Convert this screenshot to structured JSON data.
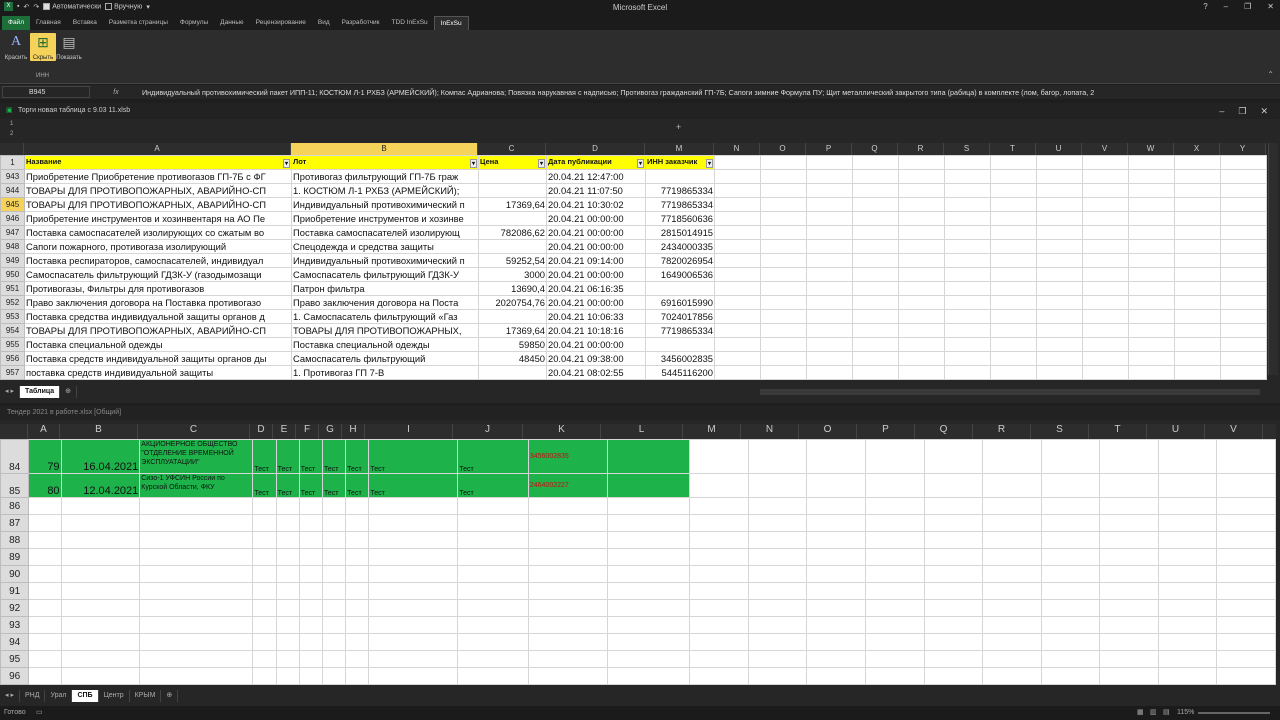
{
  "window": {
    "title": "Microsoft Excel"
  },
  "qat": {
    "auto_label": "Автоматически",
    "manual_label": "Вручную"
  },
  "ribbon_tabs": [
    "Файл",
    "Главная",
    "Вставка",
    "Разметка страницы",
    "Формулы",
    "Данные",
    "Рецензирование",
    "Вид",
    "Разработчик",
    "TDD InExSu",
    "InExSu"
  ],
  "ribbon": {
    "btn1": "Красить",
    "btn2": "Скрыть",
    "btn3": "Показать",
    "group": "ИНН"
  },
  "formula_bar": {
    "name_box": "B945",
    "fx": "fx",
    "content": "Индивидуальный противохимический пакет ИПП-11; КОСТЮМ Л-1 РХБЗ (АРМЕЙСКИЙ); Компас Адрианова; Повязка нарукавная с надписью; Противогаз гражданский ГП-7Б; Сапоги зимние Формула ПУ; Щит металлический закрытого типа (рабица) в комплекте (лом, багор, лопата, 2"
  },
  "wb1": {
    "title": "Торги новая таблица с 9.03 11.xlsb",
    "columns": [
      "A",
      "B",
      "C",
      "D",
      "M",
      "N",
      "O",
      "P",
      "Q",
      "R",
      "S",
      "T",
      "U",
      "V",
      "W",
      "X",
      "Y"
    ],
    "header_row": {
      "num": "1",
      "a": "Название",
      "b": "Лот",
      "c": "Цена",
      "d": "Дата публикации",
      "m": "ИНН заказчик"
    },
    "rows": [
      {
        "n": "943",
        "a": "Приобретение Приобретение противогазов ГП-7Б с ФГ",
        "b": "Противогаз фильтрующий ГП-7Б граж",
        "c": "",
        "d": "20.04.21 12:47:00",
        "m": ""
      },
      {
        "n": "944",
        "a": "ТОВАРЫ ДЛЯ ПРОТИВОПОЖАРНЫХ, АВАРИЙНО-СП",
        "b": "1. КОСТЮМ Л-1 РХБЗ (АРМЕЙСКИЙ);",
        "c": "",
        "d": "20.04.21 11:07:50",
        "m": "7719865334"
      },
      {
        "n": "945",
        "a": "ТОВАРЫ ДЛЯ ПРОТИВОПОЖАРНЫХ, АВАРИЙНО-СП",
        "b": "Индивидуальный противохимический п",
        "c": "17369,64",
        "d": "20.04.21 10:30:02",
        "m": "7719865334"
      },
      {
        "n": "946",
        "a": "Приобретение инструментов и хозинвентаря на АО Пе",
        "b": "Приобретение инструментов и хозинве",
        "c": "",
        "d": "20.04.21 00:00:00",
        "m": "7718560636"
      },
      {
        "n": "947",
        "a": "Поставка самоспасателей изолирующих со сжатым во",
        "b": "Поставка самоспасателей изолирующ",
        "c": "782086,62",
        "d": "20.04.21 00:00:00",
        "m": "2815014915"
      },
      {
        "n": "948",
        "a": "Сапоги пожарного, противогаза изолирующий",
        "b": "Спецодежда и средства защиты",
        "c": "",
        "d": "20.04.21 00:00:00",
        "m": "2434000335"
      },
      {
        "n": "949",
        "a": "Поставка респираторов, самоспасателей,  индивидуал",
        "b": "Индивидуальный противохимический п",
        "c": "59252,54",
        "d": "20.04.21 09:14:00",
        "m": "7820026954"
      },
      {
        "n": "950",
        "a": "Самоспасатель фильтрующий ГДЗК-У (газодымозащи",
        "b": "Самоспасатель фильтрующий ГДЗК-У",
        "c": "3000",
        "d": "20.04.21 00:00:00",
        "m": "1649006536"
      },
      {
        "n": "951",
        "a": "Противогазы, Фильтры для противогазов",
        "b": "Патрон фильтра",
        "c": "13690,4",
        "d": "20.04.21 06:16:35",
        "m": ""
      },
      {
        "n": "952",
        "a": "Право заключения договора на Поставка противогазо",
        "b": "Право заключения договора на Поста",
        "c": "2020754,76",
        "d": "20.04.21 00:00:00",
        "m": "6916015990"
      },
      {
        "n": "953",
        "a": "Поставка средства индивидуальной защиты органов д",
        "b": "1. Самоспасатель фильтрующий «Газ",
        "c": "",
        "d": "20.04.21 10:06:33",
        "m": "7024017856"
      },
      {
        "n": "954",
        "a": "ТОВАРЫ ДЛЯ ПРОТИВОПОЖАРНЫХ, АВАРИЙНО-СП",
        "b": "ТОВАРЫ ДЛЯ ПРОТИВОПОЖАРНЫХ,",
        "c": "17369,64",
        "d": "20.04.21 10:18:16",
        "m": "7719865334"
      },
      {
        "n": "955",
        "a": "Поставка специальной одежды",
        "b": "Поставка специальной одежды",
        "c": "59850",
        "d": "20.04.21 00:00:00",
        "m": ""
      },
      {
        "n": "956",
        "a": "Поставка средств индивидуальной защиты органов ды",
        "b": "Самоспасатель фильтрующий",
        "c": "48450",
        "d": "20.04.21 09:38:00",
        "m": "3456002835"
      },
      {
        "n": "957",
        "a": "поставка средств индивидуальной защиты",
        "b": "1. Противогаз ГП 7-В",
        "c": "",
        "d": "20.04.21 08:02:55",
        "m": "5445116200"
      }
    ],
    "selected_row": "945",
    "sheet_tab": "Таблица"
  },
  "wb2": {
    "title": "Тендер 2021 в работе.xlsx  [Общий]",
    "columns": [
      "A",
      "B",
      "C",
      "D",
      "E",
      "F",
      "G",
      "H",
      "I",
      "J",
      "K",
      "L",
      "M",
      "N",
      "O",
      "P",
      "Q",
      "R",
      "S",
      "T",
      "U",
      "V"
    ],
    "rows": [
      {
        "n": "84",
        "a": "79",
        "b": "16.04.2021",
        "c": "АКЦИОНЕРНОЕ ОБЩЕСТВО \"ОТДЕЛЕНИЕ ВРЕМЕННОЙ ЭКСПЛУАТАЦИИ\"",
        "d": "Тест",
        "e": "Тест",
        "f": "Тест",
        "g": "Тест",
        "h": "Тест",
        "i": "Тест",
        "j": "Тест",
        "k": "3456002835"
      },
      {
        "n": "85",
        "a": "80",
        "b": "12.04.2021",
        "c": "Сизо-1 УФСИН России по Курской Области, ФКУ",
        "d": "Тест",
        "e": "Тест",
        "f": "Тест",
        "g": "Тест",
        "h": "Тест",
        "i": "Тест",
        "j": "Тест",
        "k": "2464002227"
      }
    ],
    "empty_rows": [
      "86",
      "87",
      "88",
      "89",
      "90",
      "91",
      "92",
      "93",
      "94",
      "95",
      "96"
    ],
    "sheet_tabs": [
      "РНД",
      "Урал",
      "СПБ",
      "Центр",
      "КРЫМ"
    ],
    "active_tab": "СПБ"
  },
  "status": {
    "ready": "Готово",
    "zoom": "115%"
  },
  "colors": {
    "yellow": "#ffff00",
    "green": "#1db34a",
    "selection": "#f5d35b",
    "excel_green": "#1d6f3a"
  }
}
